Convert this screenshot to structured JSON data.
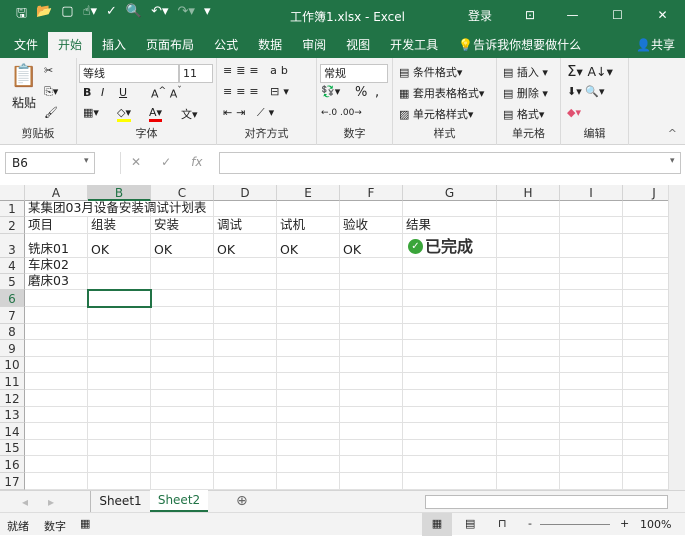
{
  "titlebar": {
    "title": "工作簿1.xlsx  -  Excel",
    "login": "登录",
    "qa_icons": [
      "save-icon",
      "open-icon",
      "new-icon",
      "touch-mode-icon",
      "spelling-icon",
      "print-preview-icon",
      "undo-icon",
      "redo-icon",
      "customize-icon"
    ]
  },
  "tabs": [
    "文件",
    "开始",
    "插入",
    "页面布局",
    "公式",
    "数据",
    "审阅",
    "视图",
    "开发工具"
  ],
  "tell_me": "告诉我你想要做什么",
  "share": "共享",
  "ribbon": {
    "clipboard": {
      "label": "剪贴板",
      "paste": "粘贴"
    },
    "font": {
      "label": "字体",
      "name": "等线",
      "size": "11",
      "bold": "B",
      "italic": "I",
      "underline": "U"
    },
    "alignment": {
      "label": "对齐方式"
    },
    "number": {
      "label": "数字",
      "format": "常规",
      "percent": "%",
      "comma": ","
    },
    "styles": {
      "label": "样式",
      "conditional": "条件格式",
      "table": "套用表格格式",
      "cell": "单元格样式"
    },
    "cells": {
      "label": "单元格",
      "insert": "插入",
      "delete": "删除",
      "format": "格式"
    },
    "editing": {
      "label": "编辑",
      "sum": "Σ"
    }
  },
  "formula_bar": {
    "name_box": "B6",
    "fx": "fx",
    "value": ""
  },
  "columns": [
    "A",
    "B",
    "C",
    "D",
    "E",
    "F",
    "G",
    "H",
    "I",
    "J"
  ],
  "rows": [
    "1",
    "2",
    "3",
    "4",
    "5",
    "6",
    "7",
    "8",
    "9",
    "10",
    "11",
    "12",
    "13",
    "14",
    "15",
    "16",
    "17"
  ],
  "cells": {
    "r1": [
      "某集团03月设备安装调试计划表"
    ],
    "r2": [
      "项目",
      "组装",
      "安装",
      "调试",
      "试机",
      "验收",
      "结果"
    ],
    "r3": [
      "铣床01",
      "OK",
      "OK",
      "OK",
      "OK",
      "OK",
      "已完成"
    ],
    "r4": [
      "车床02"
    ],
    "r5": [
      "磨床03"
    ]
  },
  "selected_cell": "B6",
  "sheets": [
    "Sheet1",
    "Sheet2"
  ],
  "active_sheet": "Sheet2",
  "status": {
    "ready": "就绪",
    "mode": "数字",
    "zoom": "100%"
  }
}
